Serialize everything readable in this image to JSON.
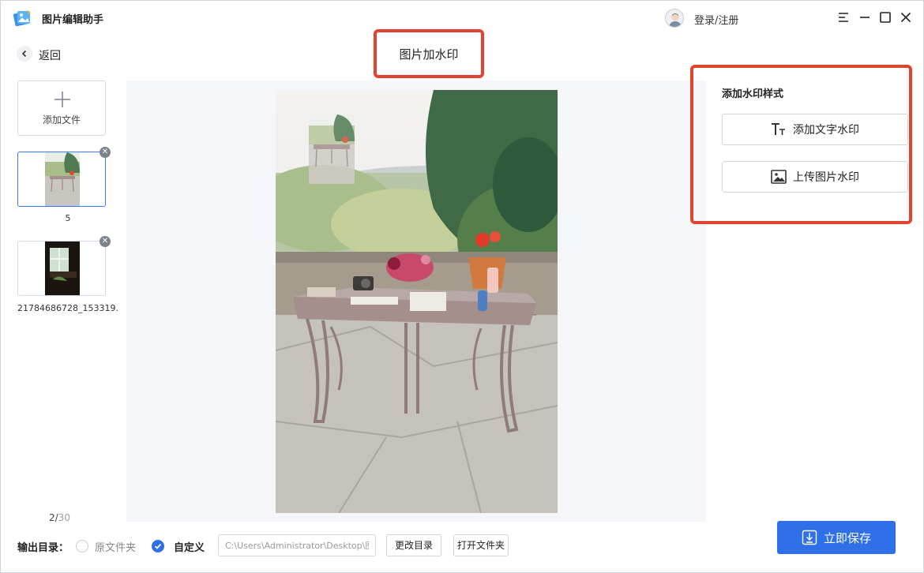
{
  "app": {
    "title": "图片编辑助手",
    "logo_icon": "app-logo-icon",
    "login_label": "登录/注册"
  },
  "window_controls": [
    "menu-icon",
    "minimize-icon",
    "maximize-icon",
    "close-icon"
  ],
  "nav": {
    "back_label": "返回",
    "page_title": "图片加水印"
  },
  "sidebar": {
    "add_file_label": "添加文件",
    "files": [
      {
        "name": "5",
        "selected": true
      },
      {
        "name": "21784686728_153319..."
      }
    ],
    "page_current": "2/",
    "page_total": "30"
  },
  "panel": {
    "title": "添加水印样式",
    "add_text_label": "添加文字水印",
    "upload_image_label": "上传图片水印"
  },
  "footer": {
    "output_label": "输出目录：",
    "option_original": "原文件夹",
    "option_custom": "自定义",
    "path_value": "C:\\Users\\Administrator\\Desktop\\图",
    "change_dir_label": "更改目录",
    "open_folder_label": "打开文件夹",
    "save_label": "立即保存"
  },
  "colors": {
    "accent": "#2f6fe8",
    "highlight_border": "#e0432e",
    "preview_bg": "#f5f6f9"
  }
}
